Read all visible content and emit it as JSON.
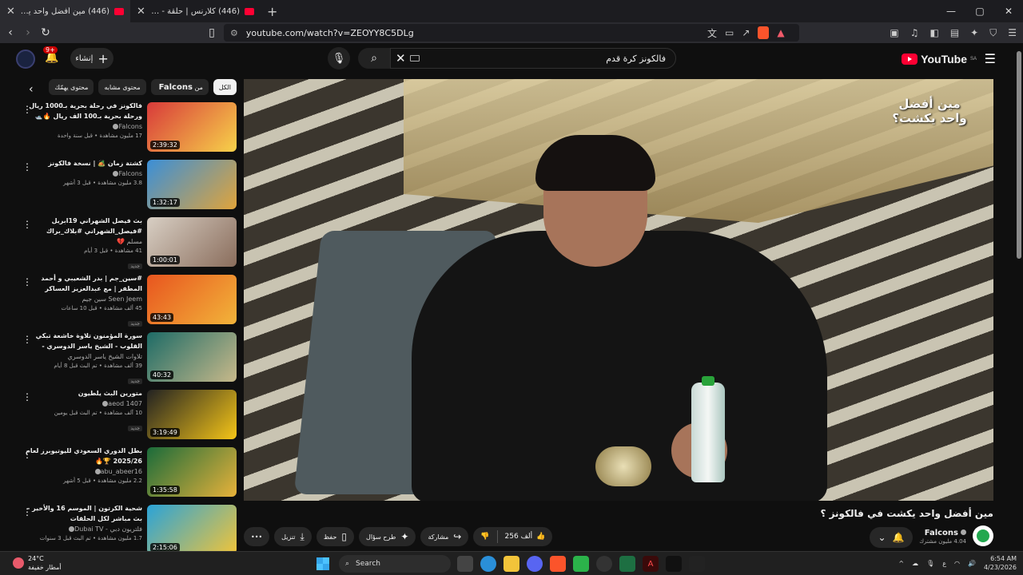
{
  "browser": {
    "tabs": [
      {
        "title": "(446) مين أفضل واحد يكشت ب...",
        "active": true
      },
      {
        "title": "(446) كلارنس | حلقة - الملعب المفقود",
        "active": false
      }
    ],
    "new_tab": "+",
    "url": "youtube.com/watch?v=ZEOYY8C5DLg",
    "window_controls": [
      "—",
      "▢",
      "✕"
    ]
  },
  "youtube": {
    "logo_text": "YouTube",
    "logo_region": "SA",
    "search_query": "فالكونز كرة قدم",
    "create_label": "إنشاء",
    "notifications": "9+",
    "chips": [
      {
        "label": "الكل",
        "active": true
      },
      {
        "prefix": "من",
        "bold": "Falcons",
        "active": false
      },
      {
        "label": "محتوى مشابه",
        "active": false
      },
      {
        "label": "محتوى يهمّك",
        "active": false
      }
    ]
  },
  "watermark": "مين أفضل واحد يكشت؟",
  "related": [
    {
      "title": "فالكونز في رحلة بحرية بـ1000 ريال ورحلة بحرية بـ100 الف ريال 🔥🛥️",
      "channel": "Falcons",
      "verified": true,
      "stats": "17 مليون مشاهدة • قبل سنة واحدة",
      "duration": "2:39:32",
      "badge": "",
      "thumb": [
        "#d83a3a",
        "#f7d24a"
      ]
    },
    {
      "title": "كشتة زمان 🏕️ | نسخة فالكونز",
      "channel": "Falcons",
      "verified": true,
      "stats": "3.8 مليون مشاهدة • قبل 3 أشهر",
      "duration": "1:32:17",
      "badge": "",
      "thumb": [
        "#3a8fd8",
        "#e0a43b"
      ]
    },
    {
      "title": "بث فيصل الشهراني 19ابريل #فيصل_الشهراني #بلاك_براك",
      "channel": "مسلم 💔",
      "verified": false,
      "stats": "41 مشاهدة • قبل 3 أيام",
      "duration": "1:00:01",
      "badge": "جديد",
      "thumb": [
        "#d8cfc4",
        "#8a6d5c"
      ]
    },
    {
      "title": "#سين_جم | بدر الشعيبي و أحمد المطفر | مع عبدالعزيز العساكر",
      "channel": "Seen Jeem سين جيم",
      "verified": false,
      "stats": "45 ألف مشاهدة • قبل 10 ساعات",
      "duration": "43:43",
      "badge": "جديد",
      "thumb": [
        "#e8551f",
        "#f2b43a"
      ]
    },
    {
      "title": "سورة المؤمنون تلاوة خاشعة تبكي القلوب - الشيخ ياسر الدوسري - Surah Al-...",
      "channel": "تلاوات الشيخ ياسر الدوسري",
      "verified": false,
      "stats": "39 ألف مشاهدة • تم البث قبل 8 أيام",
      "duration": "40:32",
      "badge": "جديد",
      "thumb": [
        "#1d6b66",
        "#c8b98a"
      ]
    },
    {
      "title": "متورين البث يلطيون",
      "channel": "aeod 1407",
      "verified": true,
      "stats": "10 آلف مشاهدة • تم البث قبل يومين",
      "duration": "3:19:49",
      "badge": "جديد",
      "thumb": [
        "#222222",
        "#f5c518"
      ]
    },
    {
      "title": "بطل الدوري السعودي لليوتيوبرز لعام 2025/26 🏆🔥",
      "channel": "abu_abeer16",
      "verified": true,
      "stats": "2.2 مليون مشاهدة • قبل 5 أشهر",
      "duration": "1:35:58",
      "badge": "",
      "thumb": [
        "#1a6b3a",
        "#e8b23a"
      ]
    },
    {
      "title": "شحية الكرتون | الموسم 16 والأخير - بث مباشر لكل الحلقات",
      "channel": "فلتريون دبي - Dubai TV",
      "verified": true,
      "stats": "1.7 مليون مشاهدة • تم البث قبل 3 سنوات",
      "duration": "2:15:06",
      "badge": "",
      "thumb": [
        "#2aa3d8",
        "#f0c43a"
      ]
    }
  ],
  "video": {
    "title": "مين أفضل واحد يكشت في فالكونز ؟",
    "channel": "Falcons",
    "subscribers": "4.04 مليون مشترك",
    "likes": "256 ألف",
    "share": "مشاركة",
    "ask": "طرح سؤال",
    "save": "حفظ",
    "download": "تنزيل",
    "more": "•••"
  },
  "taskbar": {
    "temperature": "24°C",
    "weather_text": "أمطار خفيفة",
    "search_label": "Search",
    "time": "6:54 AM",
    "date": "4/23/2026",
    "lang": "ع"
  }
}
